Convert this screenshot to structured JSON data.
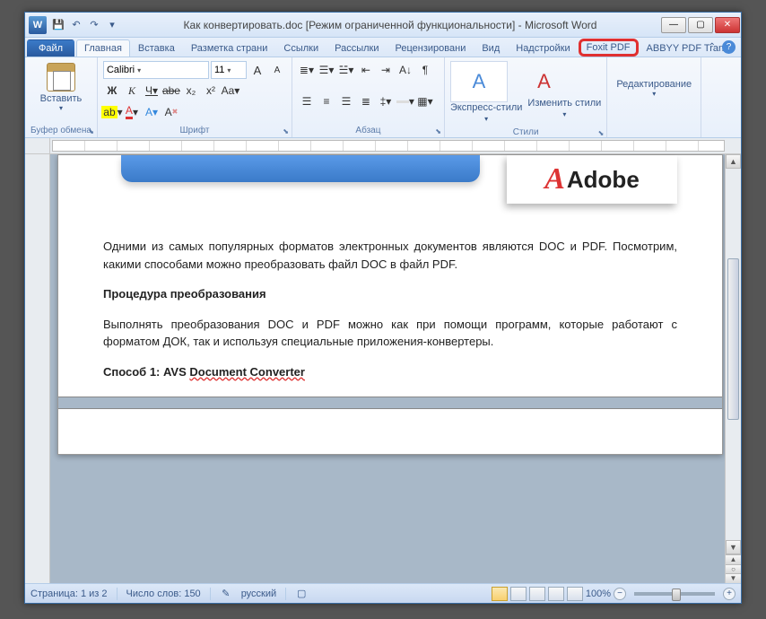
{
  "title": "Как конвертировать.doc [Режим ограниченной функциональности]  -  Microsoft Word",
  "word_icon": "W",
  "tabs": {
    "file": "Файл",
    "home": "Главная",
    "insert": "Вставка",
    "layout": "Разметка страни",
    "refs": "Ссылки",
    "mail": "Рассылки",
    "review": "Рецензировани",
    "view": "Вид",
    "addins": "Надстройки",
    "foxit": "Foxit PDF",
    "abbyy": "ABBYY PDF Trans"
  },
  "ribbon": {
    "paste": "Вставить",
    "clipboard": "Буфер обмена",
    "font_name": "Calibri",
    "font_size": "11",
    "font": "Шрифт",
    "paragraph": "Абзац",
    "quick_styles": "Экспресс-стили",
    "change_styles": "Изменить стили",
    "styles": "Стили",
    "editing": "Редактирование",
    "bold": "Ж",
    "italic": "К",
    "underline": "Ч",
    "strike": "abe",
    "sub": "x₂",
    "sup": "x²",
    "case": "Aa",
    "grow": "A",
    "shrink": "A",
    "clear": "A"
  },
  "document": {
    "adobe": "Adobe",
    "p1": "Одними из самых популярных форматов электронных документов являются DOC и PDF. Посмотрим, какими способами можно преобразовать файл DOC в файл PDF.",
    "p2": "Процедура преобразования",
    "p3": "Выполнять преобразования DOC и PDF можно как при помощи программ, которые работают с форматом ДОК, так и используя специальные приложения-конвертеры.",
    "p4_prefix": "Способ 1: AVS ",
    "p4_wavy": "Document Converter"
  },
  "status": {
    "page": "Страница: 1 из 2",
    "words": "Число слов: 150",
    "lang": "русский",
    "zoom": "100%"
  }
}
